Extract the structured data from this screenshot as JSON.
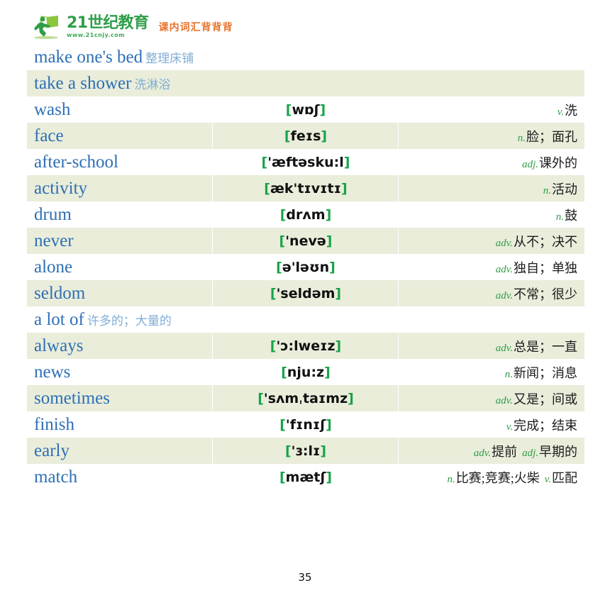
{
  "header": {
    "logo_number": "21",
    "logo_main": "21世纪教育",
    "logo_url": "www.21cnjy.com",
    "tagline": "课内词汇背背背",
    "logo_green": "#2f9e49",
    "tagline_orange": "#e8722c"
  },
  "table": {
    "row_tint": "#e9edda",
    "word_color": "#2e6fb5",
    "bracket_color": "#17a24a",
    "pos_color": "#2f9e49",
    "rows": [
      {
        "type": "phrase",
        "shade": "white",
        "english": "make one's bed",
        "chinese": "整理床铺"
      },
      {
        "type": "phrase",
        "shade": "green",
        "english": "take a shower",
        "chinese": "洗淋浴"
      },
      {
        "type": "word",
        "shade": "white",
        "word": "wash",
        "ipa": "wɒʃ",
        "senses": [
          {
            "pos": "v.",
            "meaning": "洗"
          }
        ]
      },
      {
        "type": "word",
        "shade": "green",
        "word": "face",
        "ipa": "feɪs",
        "senses": [
          {
            "pos": "n.",
            "meaning": "脸；面孔"
          }
        ]
      },
      {
        "type": "word",
        "shade": "white",
        "word": "after-school",
        "ipa": "'æftəsku:l",
        "senses": [
          {
            "pos": "adj.",
            "meaning": "课外的"
          }
        ]
      },
      {
        "type": "word",
        "shade": "green",
        "word": "activity",
        "ipa": "æk'tɪvɪtɪ",
        "senses": [
          {
            "pos": "n.",
            "meaning": "活动"
          }
        ]
      },
      {
        "type": "word",
        "shade": "white",
        "word": "drum",
        "ipa": "drʌm",
        "senses": [
          {
            "pos": "n.",
            "meaning": "鼓"
          }
        ]
      },
      {
        "type": "word",
        "shade": "green",
        "word": "never",
        "ipa": "'nevə",
        "senses": [
          {
            "pos": "adv.",
            "meaning": "从不；决不"
          }
        ]
      },
      {
        "type": "word",
        "shade": "white",
        "word": "alone",
        "ipa": "ə'ləʊn",
        "senses": [
          {
            "pos": "adv.",
            "meaning": "独自；单独"
          }
        ]
      },
      {
        "type": "word",
        "shade": "green",
        "word": "seldom",
        "ipa": "'seldəm",
        "senses": [
          {
            "pos": "adv.",
            "meaning": "不常；很少"
          }
        ]
      },
      {
        "type": "phrase",
        "shade": "white",
        "english": "a lot of",
        "chinese": "许多的；大量的"
      },
      {
        "type": "word",
        "shade": "green",
        "word": "always",
        "ipa": "'ɔ:lweɪz",
        "senses": [
          {
            "pos": "adv.",
            "meaning": "总是；一直"
          }
        ]
      },
      {
        "type": "word",
        "shade": "white",
        "word": "news",
        "ipa": "nju:z",
        "senses": [
          {
            "pos": "n.",
            "meaning": "新闻；消息"
          }
        ]
      },
      {
        "type": "word",
        "shade": "green",
        "word": "sometimes",
        "ipa": "'sʌmˌtaɪmz",
        "senses": [
          {
            "pos": "adv.",
            "meaning": "又是；间或"
          }
        ]
      },
      {
        "type": "word",
        "shade": "white",
        "word": "finish",
        "ipa": "'fɪnɪʃ",
        "senses": [
          {
            "pos": "v.",
            "meaning": "完成；结束"
          }
        ]
      },
      {
        "type": "word",
        "shade": "green",
        "word": "early",
        "ipa": "'ɜ:lɪ",
        "senses": [
          {
            "pos": "adv.",
            "meaning": "提前"
          },
          {
            "pos": "adj.",
            "meaning": "早期的"
          }
        ]
      },
      {
        "type": "word",
        "shade": "white",
        "word": "match",
        "ipa": "mætʃ",
        "senses": [
          {
            "pos": "n.",
            "meaning": "比赛;竞赛;火柴"
          },
          {
            "pos": "v.",
            "meaning": "匹配"
          }
        ]
      }
    ]
  },
  "footer": {
    "page_number": "35"
  }
}
